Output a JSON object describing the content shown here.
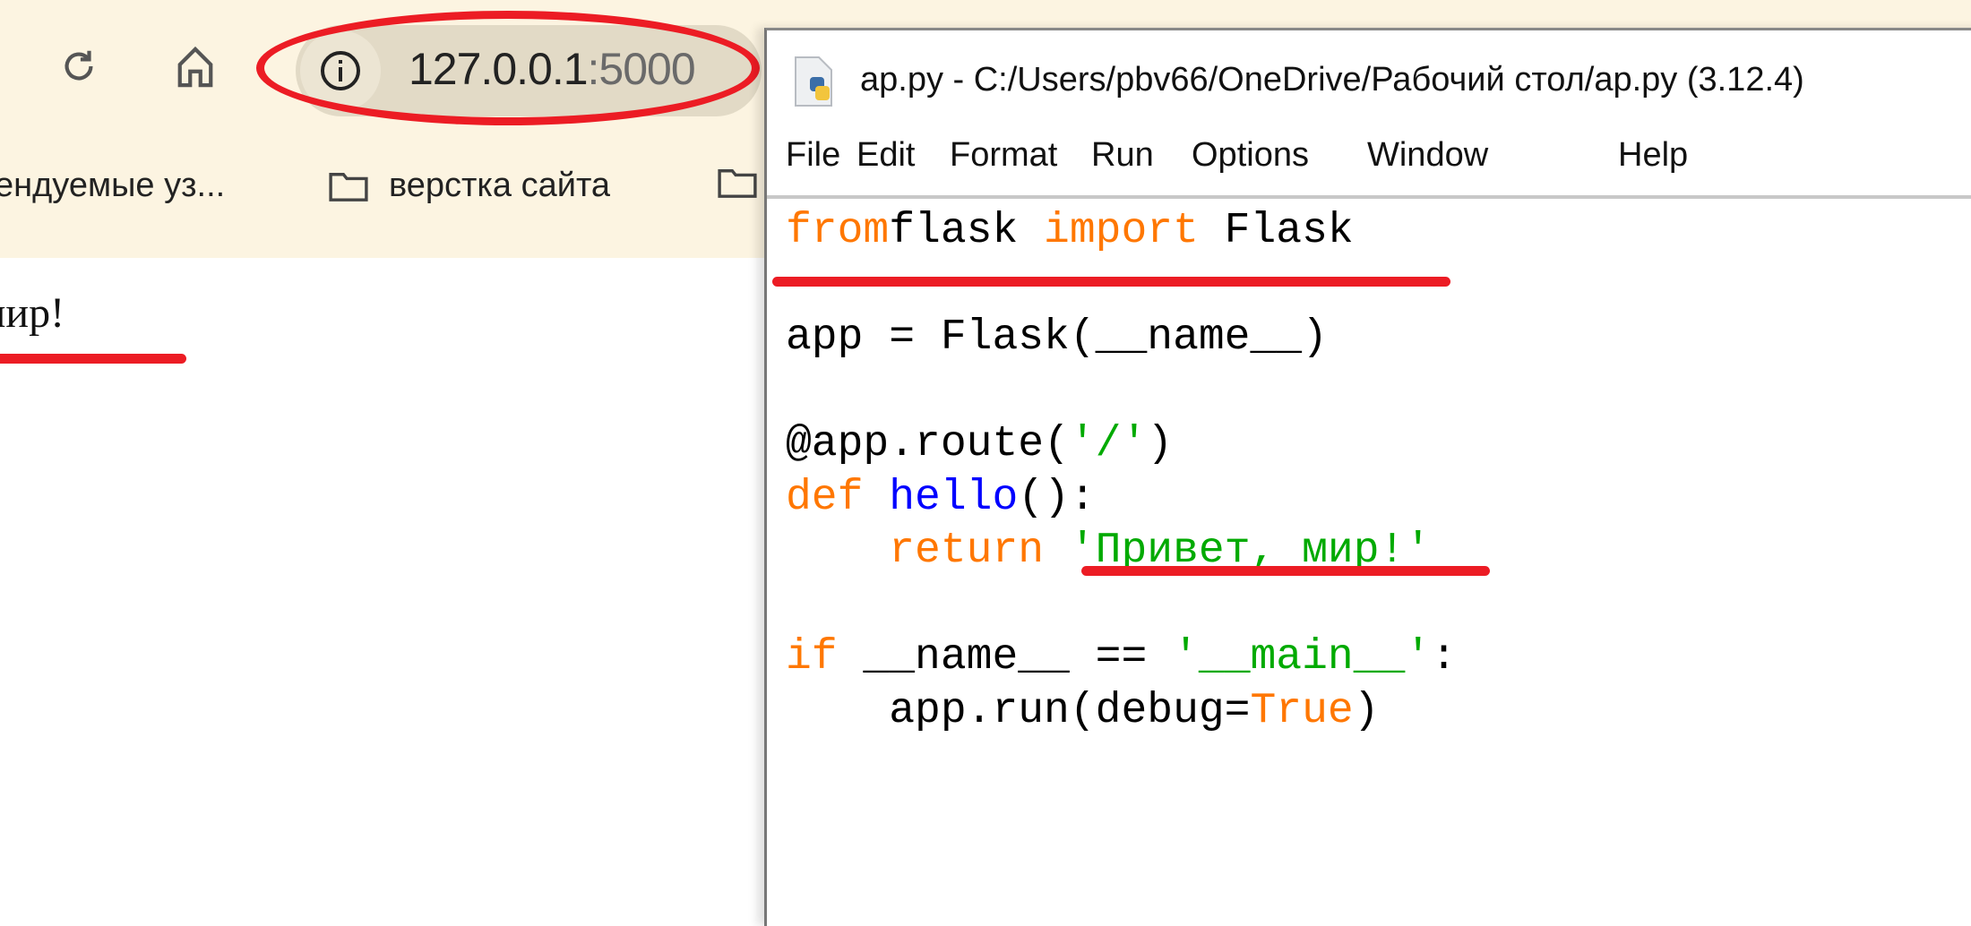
{
  "browser": {
    "url_host": "127.0.0.1",
    "url_port": ":5000",
    "bookmarks": [
      {
        "label": "ендуемые уз...",
        "icon": "none"
      },
      {
        "label": "верстка сайта",
        "icon": "folder-icon"
      },
      {
        "label": "",
        "icon": "folder-icon"
      }
    ],
    "page_text": "мир!"
  },
  "idle": {
    "title": "ap.py - C:/Users/pbv66/OneDrive/Рабочий стол/ap.py (3.12.4)",
    "menu": [
      "File",
      "Edit",
      "Format",
      "Run",
      "Options",
      "Window",
      "Help"
    ],
    "code_lines": [
      [
        [
          "kw",
          "from"
        ],
        [
          "",
          "flask "
        ],
        [
          "kw",
          "import"
        ],
        [
          "",
          " Flask"
        ]
      ],
      [],
      [
        [
          "",
          "app = Flask(__name__)"
        ]
      ],
      [],
      [
        [
          "",
          "@app.route("
        ],
        [
          "str",
          "'/'"
        ],
        [
          "",
          ")"
        ]
      ],
      [
        [
          "kw",
          "def"
        ],
        [
          "",
          " "
        ],
        [
          "def",
          "hello"
        ],
        [
          "",
          "():"
        ]
      ],
      [
        [
          "",
          "    "
        ],
        [
          "kw",
          "return"
        ],
        [
          "",
          " "
        ],
        [
          "str",
          "'Привет, мир!'"
        ]
      ],
      [],
      [
        [
          "kw",
          "if"
        ],
        [
          "",
          " __name__ == "
        ],
        [
          "str",
          "'__main__'"
        ],
        [
          "",
          ":"
        ]
      ],
      [
        [
          "",
          "    app.run(debug="
        ],
        [
          "bi",
          "True"
        ],
        [
          "",
          ")"
        ]
      ]
    ]
  },
  "colors": {
    "annotation": "#ec1c24",
    "keyword": "#ff7700",
    "definition": "#0000ff",
    "string": "#00aa00",
    "toolbar_bg": "#fcf4e1"
  }
}
